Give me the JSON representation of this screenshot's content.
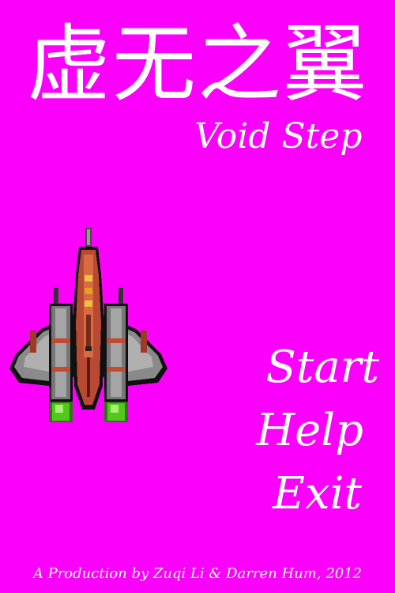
{
  "game": {
    "title_cn": "虚无之翼",
    "title_en": "Void Step",
    "credits": "A Production by Zuqi Li & Darren Hum, 2012"
  },
  "menu": {
    "start_label": "Start",
    "help_label": "Help",
    "exit_label": "Exit"
  },
  "colors": {
    "background": "#fb00fb",
    "text": "#ffffff"
  },
  "icons": {
    "player_ship": "spaceship-sprite"
  }
}
